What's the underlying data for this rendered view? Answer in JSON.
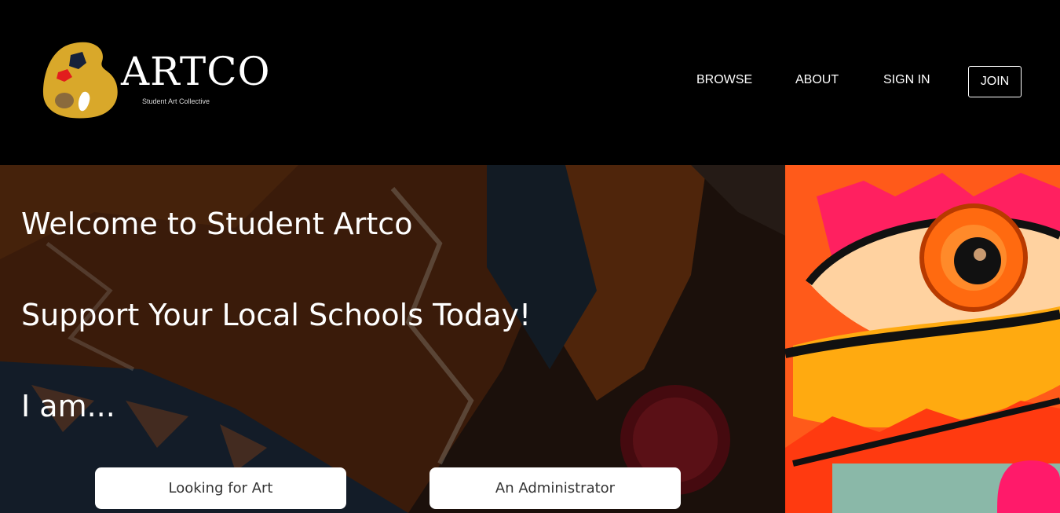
{
  "brand": {
    "name": "ARTCO",
    "tagline": "Student Art Collective"
  },
  "nav": {
    "browse": "BROWSE",
    "about": "ABOUT",
    "sign_in": "SIGN IN",
    "join": "JOIN"
  },
  "hero": {
    "welcome": "Welcome to Student Artco",
    "support": "Support Your Local Schools Today!",
    "i_am": "I am...",
    "buttons": {
      "art_seeker": "Looking for Art",
      "administrator": "An Administrator"
    }
  },
  "colors": {
    "header_bg": "#000000",
    "palette_gold": "#d9a82a",
    "cta_bg": "#ffffff",
    "cta_text": "#333333"
  }
}
